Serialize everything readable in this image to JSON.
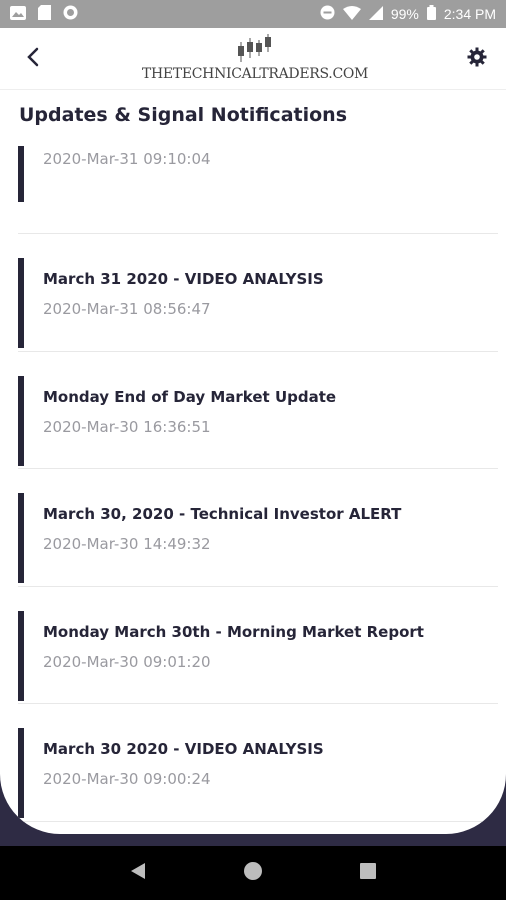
{
  "status_bar": {
    "battery": "99%",
    "time": "2:34 PM"
  },
  "header": {
    "logo_text": "THETECHNICALTRADERS.COM"
  },
  "page_title": "Updates & Signal Notifications",
  "items": [
    {
      "title": "",
      "date": "2020-Mar-31  09:10:04"
    },
    {
      "title": "March 31 2020 - VIDEO ANALYSIS",
      "date": "2020-Mar-31  08:56:47"
    },
    {
      "title": "Monday End of Day Market Update",
      "date": "2020-Mar-30  16:36:51"
    },
    {
      "title": "March 30, 2020 - Technical Investor ALERT",
      "date": "2020-Mar-30  14:49:32"
    },
    {
      "title": "Monday March 30th - Morning Market Report",
      "date": "2020-Mar-30  09:01:20"
    },
    {
      "title": "March 30 2020 - VIDEO ANALYSIS",
      "date": "2020-Mar-30  09:00:24"
    }
  ],
  "colors": {
    "accent": "#262538",
    "date_text": "#9a9aa0",
    "status_bar": "#9e9e9e"
  },
  "icons": {
    "back": "back-arrow-icon",
    "settings": "gear-icon"
  }
}
